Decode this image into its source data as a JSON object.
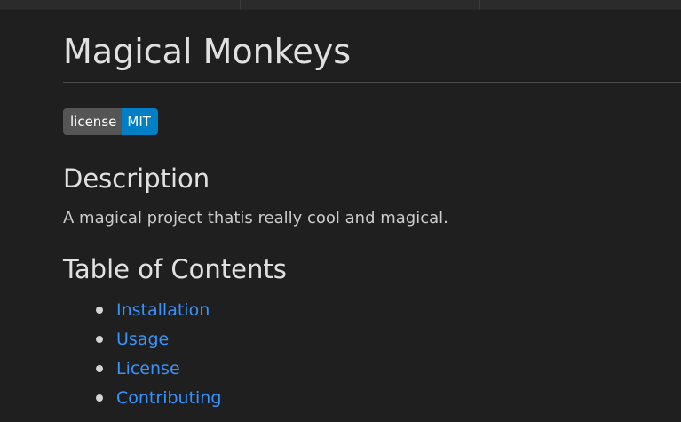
{
  "document": {
    "title": "Magical Monkeys",
    "badge": {
      "label": "license",
      "value": "MIT"
    },
    "description_heading": "Description",
    "description_text": "A magical project thatis really cool and magical.",
    "toc_heading": "Table of Contents",
    "toc_items": [
      {
        "label": "Installation"
      },
      {
        "label": "Usage"
      },
      {
        "label": "License"
      },
      {
        "label": "Contributing"
      }
    ]
  },
  "colors": {
    "background": "#1f1f1f",
    "link": "#3794ff",
    "badge_label_bg": "#555555",
    "badge_value_bg": "#007ec6"
  }
}
